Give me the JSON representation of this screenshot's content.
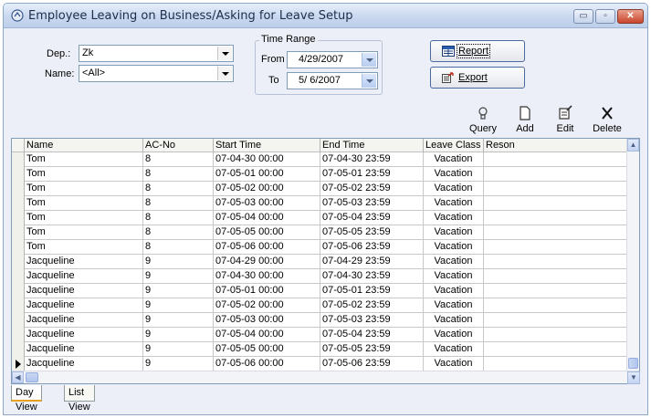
{
  "window": {
    "title": "Employee Leaving on Business/Asking for Leave Setup",
    "controls": {
      "minimize": "▭",
      "maximize": "▫",
      "close": "✕"
    }
  },
  "filters": {
    "dep_label": "Dep.:",
    "dep_value": "Zk",
    "name_label": "Name:",
    "name_value": "<All>",
    "time_range_title": "Time Range",
    "from_label": "From",
    "from_value": "4/29/2007",
    "to_label": "To",
    "to_value": "5/ 6/2007"
  },
  "buttons": {
    "report_label": "Report",
    "export_label": "Export"
  },
  "toolbar": {
    "query_label": "Query",
    "add_label": "Add",
    "edit_label": "Edit",
    "delete_label": "Delete"
  },
  "grid": {
    "columns": [
      "Name",
      "AC-No",
      "Start Time",
      "End Time",
      "Leave Class",
      "Reson"
    ],
    "rows": [
      [
        "Tom",
        "8",
        "07-04-30 00:00",
        "07-04-30 23:59",
        "Vacation",
        ""
      ],
      [
        "Tom",
        "8",
        "07-05-01 00:00",
        "07-05-01 23:59",
        "Vacation",
        ""
      ],
      [
        "Tom",
        "8",
        "07-05-02 00:00",
        "07-05-02 23:59",
        "Vacation",
        ""
      ],
      [
        "Tom",
        "8",
        "07-05-03 00:00",
        "07-05-03 23:59",
        "Vacation",
        ""
      ],
      [
        "Tom",
        "8",
        "07-05-04 00:00",
        "07-05-04 23:59",
        "Vacation",
        ""
      ],
      [
        "Tom",
        "8",
        "07-05-05 00:00",
        "07-05-05 23:59",
        "Vacation",
        ""
      ],
      [
        "Tom",
        "8",
        "07-05-06 00:00",
        "07-05-06 23:59",
        "Vacation",
        ""
      ],
      [
        "Jacqueline",
        "9",
        "07-04-29 00:00",
        "07-04-29 23:59",
        "Vacation",
        ""
      ],
      [
        "Jacqueline",
        "9",
        "07-04-30 00:00",
        "07-04-30 23:59",
        "Vacation",
        ""
      ],
      [
        "Jacqueline",
        "9",
        "07-05-01 00:00",
        "07-05-01 23:59",
        "Vacation",
        ""
      ],
      [
        "Jacqueline",
        "9",
        "07-05-02 00:00",
        "07-05-02 23:59",
        "Vacation",
        ""
      ],
      [
        "Jacqueline",
        "9",
        "07-05-03 00:00",
        "07-05-03 23:59",
        "Vacation",
        ""
      ],
      [
        "Jacqueline",
        "9",
        "07-05-04 00:00",
        "07-05-04 23:59",
        "Vacation",
        ""
      ],
      [
        "Jacqueline",
        "9",
        "07-05-05 00:00",
        "07-05-05 23:59",
        "Vacation",
        ""
      ],
      [
        "Jacqueline",
        "9",
        "07-05-06 00:00",
        "07-05-06 23:59",
        "Vacation",
        ""
      ]
    ],
    "current_row": 14
  },
  "tabs": [
    {
      "label": "Day View",
      "active": true
    },
    {
      "label": "List View",
      "active": false
    }
  ],
  "icons": {
    "title": "app-icon",
    "query": "bulb-icon",
    "add": "new-page-icon",
    "edit": "edit-icon",
    "delete": "delete-icon",
    "report": "report-icon",
    "export": "export-icon"
  }
}
